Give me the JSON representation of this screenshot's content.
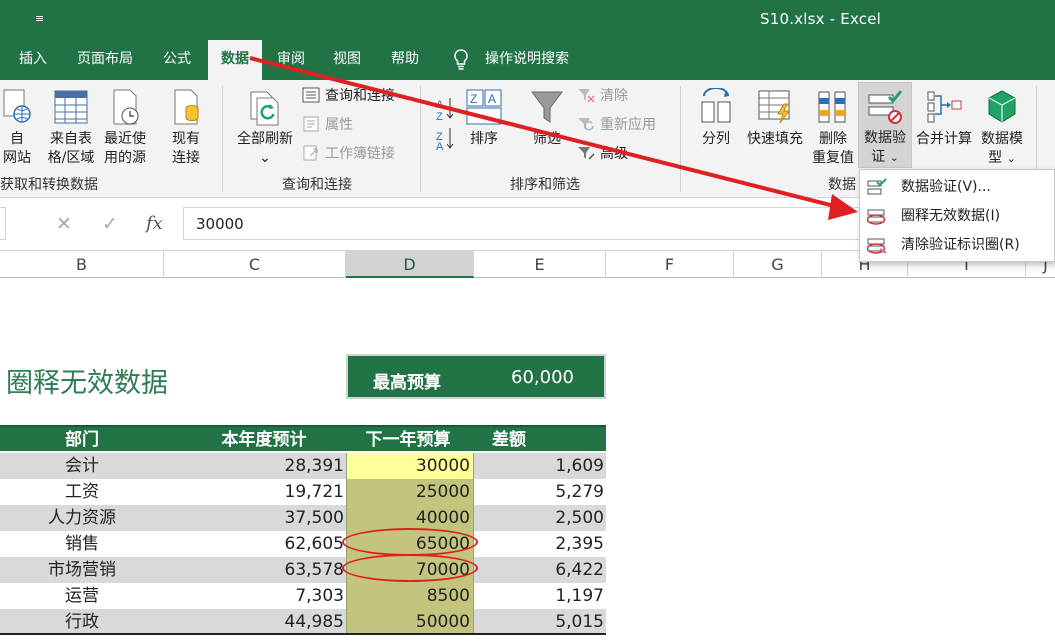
{
  "titlebar": {
    "quick_access_glyph": "≡",
    "title": "S10.xlsx  -  Excel"
  },
  "tabs": [
    {
      "label": "插入"
    },
    {
      "label": "页面布局"
    },
    {
      "label": "公式"
    },
    {
      "label": "数据",
      "active": true
    },
    {
      "label": "审阅"
    },
    {
      "label": "视图"
    },
    {
      "label": "帮助"
    }
  ],
  "tell_me": "操作说明搜索",
  "ribbon": {
    "get_data": {
      "web_line1": "自",
      "web_line2": "网站",
      "table_line1": "来自表",
      "table_line2": "格/区域",
      "recent_line1": "最近使",
      "recent_line2": "用的源",
      "existing_line1": "现有",
      "existing_line2": "连接",
      "group_label": "获取和转换数据"
    },
    "queries": {
      "refresh_line1": "全部刷新",
      "refresh_caret": "⌄",
      "queries_connections": "查询和连接",
      "properties": "属性",
      "edit_links": "工作簿链接",
      "group_label": "查询和连接"
    },
    "sort_filter": {
      "sort": "排序",
      "filter": "筛选",
      "clear": "清除",
      "reapply": "重新应用",
      "advanced": "高级",
      "group_label": "排序和筛选"
    },
    "data_tools": {
      "text_to_columns": "分列",
      "flash_fill": "快速填充",
      "remove_dup_line1": "删除",
      "remove_dup_line2": "重复值",
      "validation_line1": "数据验",
      "validation_line2": "证",
      "consolidate": "合并计算",
      "data_model_line1": "数据模",
      "data_model_line2": "型",
      "group_label": "数据"
    }
  },
  "formula_bar": {
    "fx": "fx",
    "cancel": "✕",
    "enter": "✓",
    "value": "30000"
  },
  "columns": [
    "B",
    "C",
    "D",
    "E",
    "F",
    "G",
    "H",
    "I",
    "J"
  ],
  "selected_column": "D",
  "sheet": {
    "title": "圈释无效数据",
    "max_budget_label": "最高预算",
    "max_budget_value": "60,000",
    "table_headers": {
      "dept": "部门",
      "current": "本年度预计",
      "next": "下一年预算",
      "diff": "差额"
    },
    "rows": [
      {
        "dept": "会计",
        "current": "28,391",
        "next": "30000",
        "diff": "1,609"
      },
      {
        "dept": "工资",
        "current": "19,721",
        "next": "25000",
        "diff": "5,279"
      },
      {
        "dept": "人力资源",
        "current": "37,500",
        "next": "40000",
        "diff": "2,500"
      },
      {
        "dept": "销售",
        "current": "62,605",
        "next": "65000",
        "diff": "2,395",
        "circled": true
      },
      {
        "dept": "市场营销",
        "current": "63,578",
        "next": "70000",
        "diff": "6,422",
        "circled": true
      },
      {
        "dept": "运营",
        "current": "7,303",
        "next": "8500",
        "diff": "1,197"
      },
      {
        "dept": "行政",
        "current": "44,985",
        "next": "50000",
        "diff": "5,015"
      }
    ]
  },
  "dropdown": {
    "items": [
      {
        "label": "数据验证(V)..."
      },
      {
        "label": "圈释无效数据(I)"
      },
      {
        "label": "清除验证标识圈(R)"
      }
    ]
  },
  "colors": {
    "excel_green": "#217346",
    "annotation_red": "#e02020",
    "selected_fill": "#c3c57e",
    "active_cell_fill": "#ffff99"
  }
}
